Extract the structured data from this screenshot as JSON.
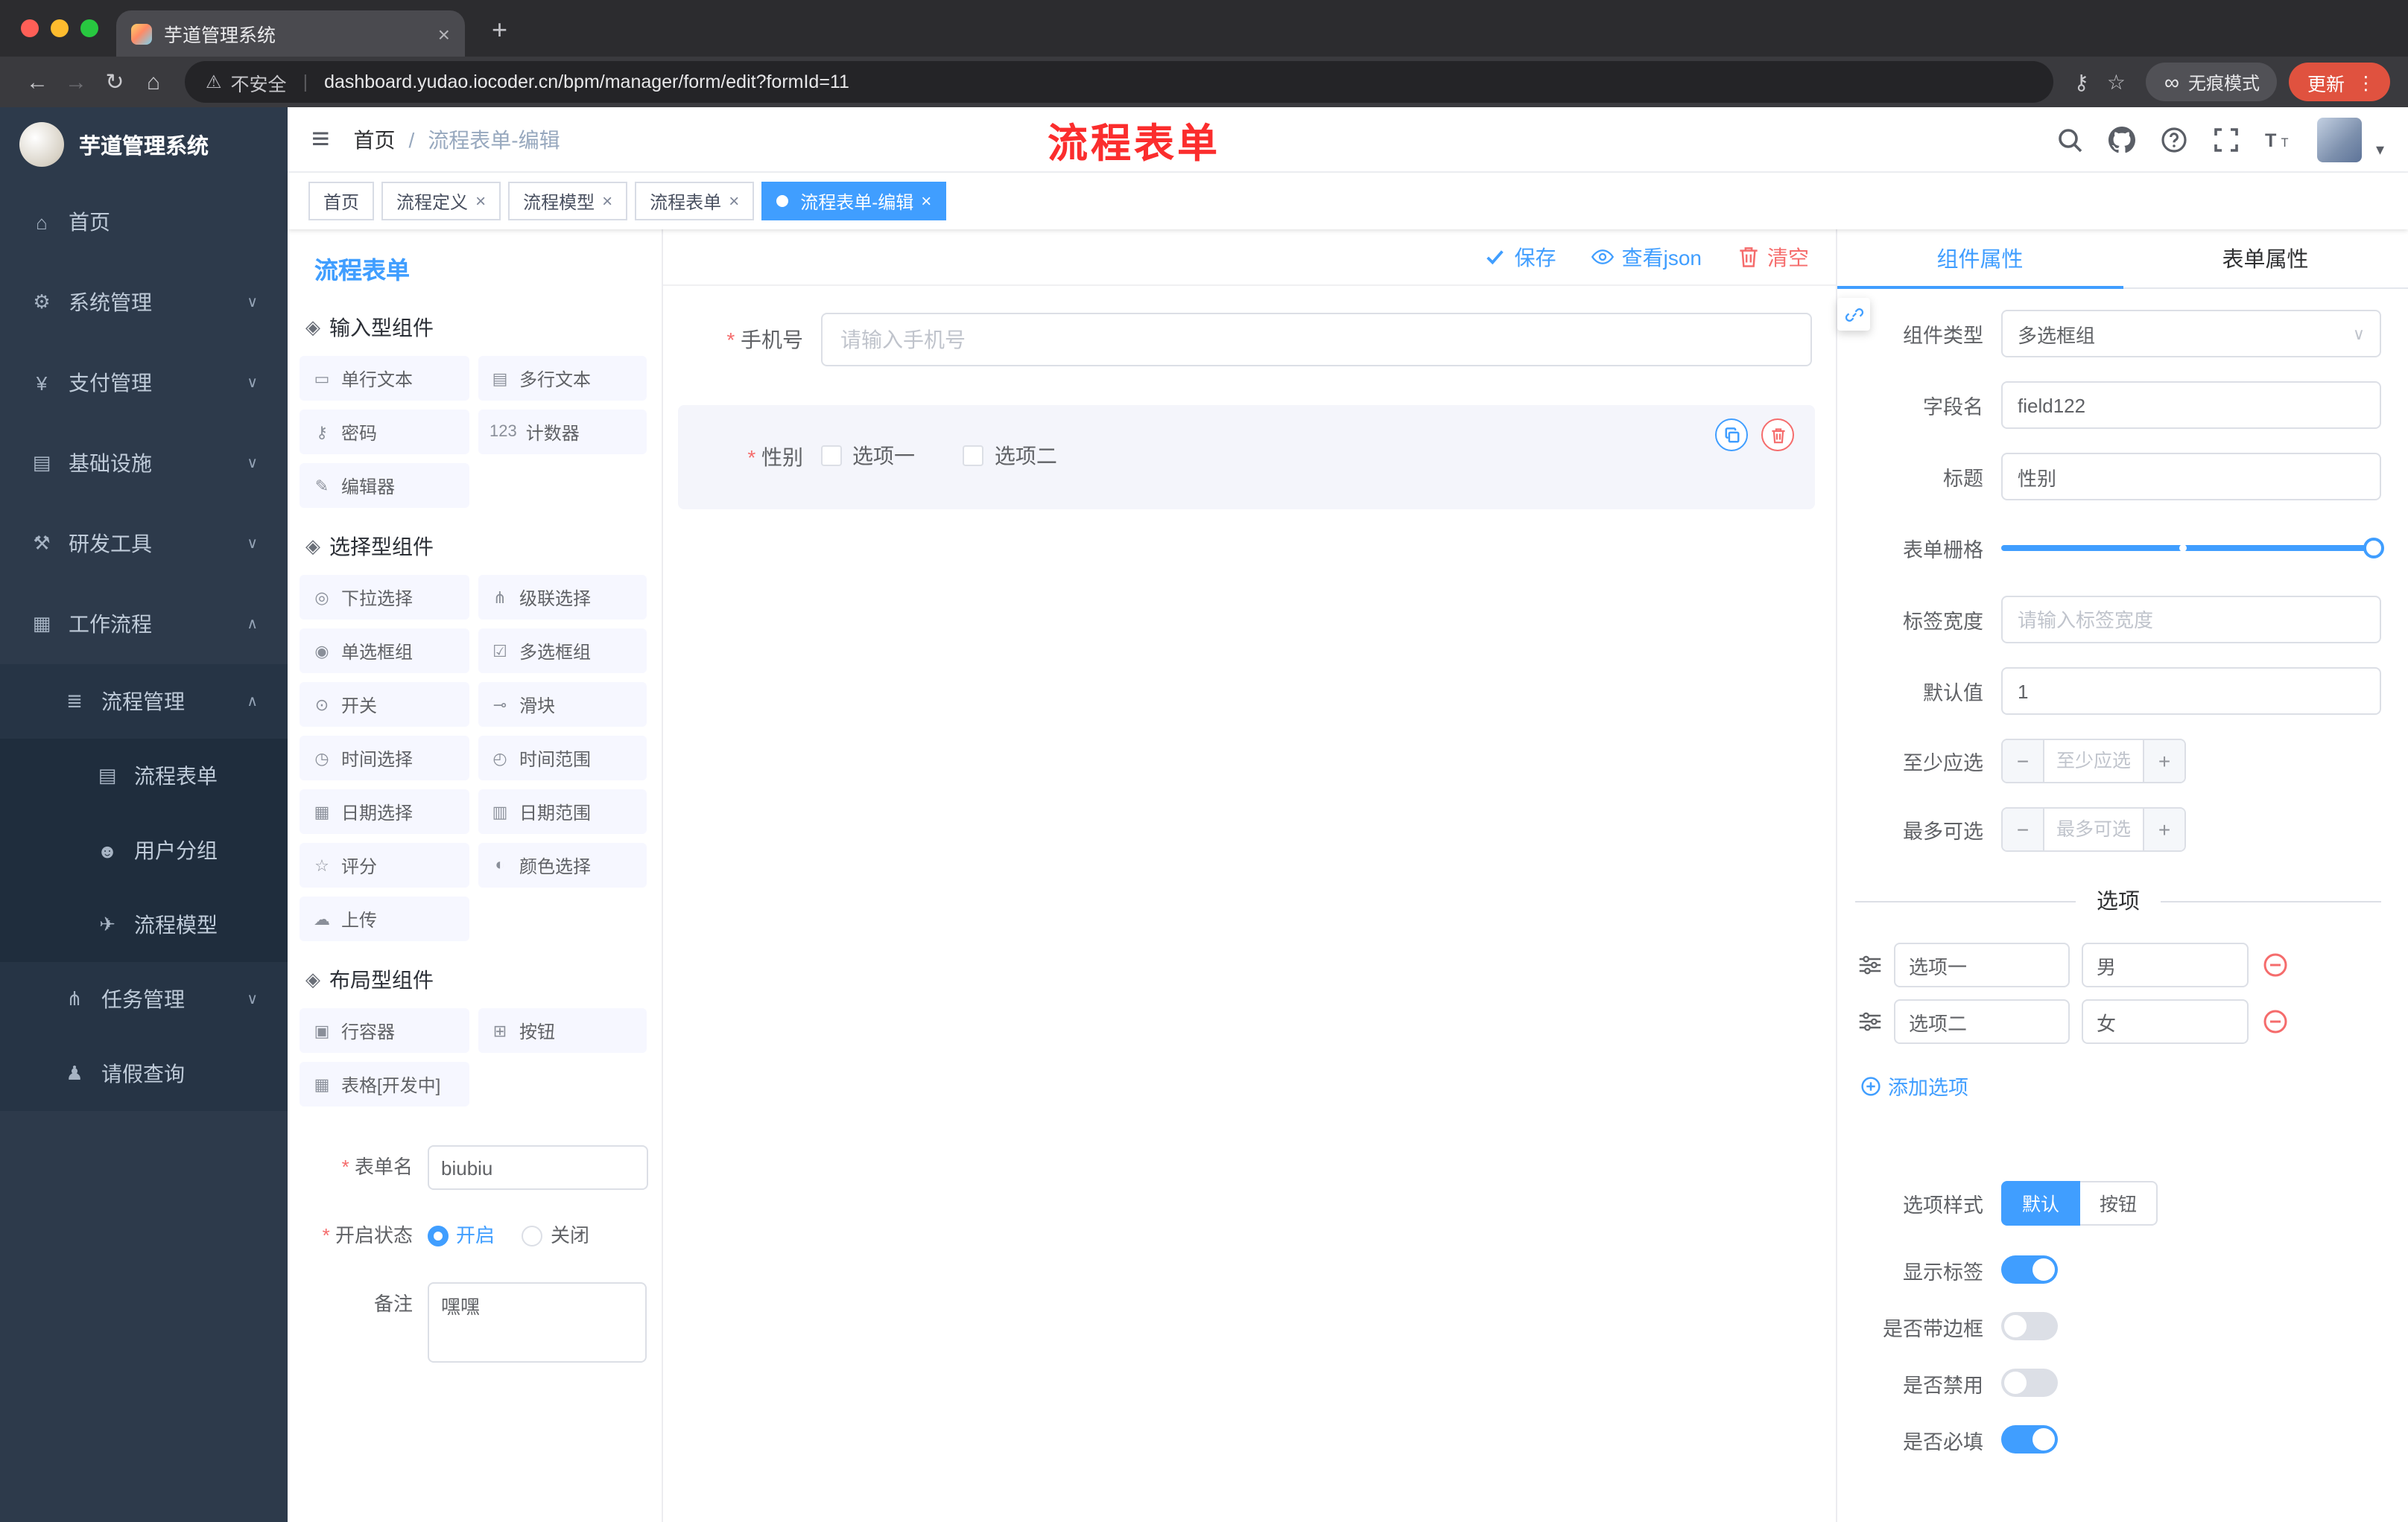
{
  "browser": {
    "tab_title": "芋道管理系统",
    "security": "不安全",
    "url": "dashboard.yudao.iocoder.cn/bpm/manager/form/edit?formId=11",
    "incognito": "无痕模式",
    "update": "更新"
  },
  "sidebar": {
    "app_title": "芋道管理系统",
    "items": [
      {
        "icon": "⌂",
        "label": "首页",
        "chevron": ""
      },
      {
        "icon": "⚙",
        "label": "系统管理",
        "chevron": "∨"
      },
      {
        "icon": "¥",
        "label": "支付管理",
        "chevron": "∨"
      },
      {
        "icon": "▤",
        "label": "基础设施",
        "chevron": "∨"
      },
      {
        "icon": "⚒",
        "label": "研发工具",
        "chevron": "∨"
      },
      {
        "icon": "▦",
        "label": "工作流程",
        "chevron": "∧"
      },
      {
        "icon": "≣",
        "label": "流程管理",
        "chevron": "∧"
      },
      {
        "icon": "▤",
        "label": "流程表单",
        "chevron": ""
      },
      {
        "icon": "☻",
        "label": "用户分组",
        "chevron": ""
      },
      {
        "icon": "✈",
        "label": "流程模型",
        "chevron": ""
      },
      {
        "icon": "⋔",
        "label": "任务管理",
        "chevron": "∨"
      },
      {
        "icon": "♟",
        "label": "请假查询",
        "chevron": ""
      }
    ]
  },
  "header": {
    "breadcrumb_home": "首页",
    "breadcrumb_sep": "/",
    "breadcrumb_current": "流程表单-编辑",
    "annotation": "流程表单"
  },
  "tags": [
    {
      "label": "首页"
    },
    {
      "label": "流程定义"
    },
    {
      "label": "流程模型"
    },
    {
      "label": "流程表单"
    },
    {
      "label": "流程表单-编辑"
    }
  ],
  "panel": {
    "title": "流程表单",
    "groups": [
      {
        "icon": "◈",
        "title": "输入型组件",
        "items": [
          {
            "icon": "▭",
            "label": "单行文本"
          },
          {
            "icon": "▤",
            "label": "多行文本"
          },
          {
            "icon": "⚷",
            "label": "密码"
          },
          {
            "icon": "123",
            "label": "计数器"
          },
          {
            "icon": "✎",
            "label": "编辑器"
          }
        ]
      },
      {
        "icon": "◈",
        "title": "选择型组件",
        "items": [
          {
            "icon": "◎",
            "label": "下拉选择"
          },
          {
            "icon": "⋔",
            "label": "级联选择"
          },
          {
            "icon": "◉",
            "label": "单选框组"
          },
          {
            "icon": "☑",
            "label": "多选框组"
          },
          {
            "icon": "⊙",
            "label": "开关"
          },
          {
            "icon": "⊸",
            "label": "滑块"
          },
          {
            "icon": "◷",
            "label": "时间选择"
          },
          {
            "icon": "◴",
            "label": "时间范围"
          },
          {
            "icon": "▦",
            "label": "日期选择"
          },
          {
            "icon": "▥",
            "label": "日期范围"
          },
          {
            "icon": "☆",
            "label": "评分"
          },
          {
            "icon": "◐",
            "label": "颜色选择"
          },
          {
            "icon": "☁",
            "label": "上传"
          }
        ]
      },
      {
        "icon": "◈",
        "title": "布局型组件",
        "items": [
          {
            "icon": "▣",
            "label": "行容器"
          },
          {
            "icon": "⊞",
            "label": "按钮"
          },
          {
            "icon": "▦",
            "label": "表格[开发中]"
          }
        ]
      }
    ],
    "form": {
      "name_label": "表单名",
      "name_value": "biubiu",
      "status_label": "开启状态",
      "status_on": "开启",
      "status_off": "关闭",
      "remark_label": "备注",
      "remark_value": "嘿嘿"
    }
  },
  "canvas": {
    "save": "保存",
    "view_json": "查看json",
    "clear": "清空",
    "phone_label": "手机号",
    "phone_placeholder": "请输入手机号",
    "gender_label": "性别",
    "gender_options": [
      "选项一",
      "选项二"
    ]
  },
  "props": {
    "tab_component": "组件属性",
    "tab_form": "表单属性",
    "rows": {
      "type_label": "组件类型",
      "type_value": "多选框组",
      "field_label": "字段名",
      "field_value": "field122",
      "title_label": "标题",
      "title_value": "性别",
      "grid_label": "表单栅格",
      "width_label": "标签宽度",
      "width_placeholder": "请输入标签宽度",
      "default_label": "默认值",
      "default_value": "1",
      "min_label": "至少应选",
      "min_placeholder": "至少应选",
      "max_label": "最多可选",
      "max_placeholder": "最多可选"
    },
    "options": {
      "divider": "选项",
      "rows": [
        {
          "label": "选项一",
          "value": "男"
        },
        {
          "label": "选项二",
          "value": "女"
        }
      ],
      "add": "添加选项"
    },
    "style": {
      "label": "选项样式",
      "default": "默认",
      "button": "按钮"
    },
    "switches": [
      {
        "label": "显示标签",
        "on": true
      },
      {
        "label": "是否带边框",
        "on": false
      },
      {
        "label": "是否禁用",
        "on": false
      },
      {
        "label": "是否必填",
        "on": true
      }
    ]
  }
}
